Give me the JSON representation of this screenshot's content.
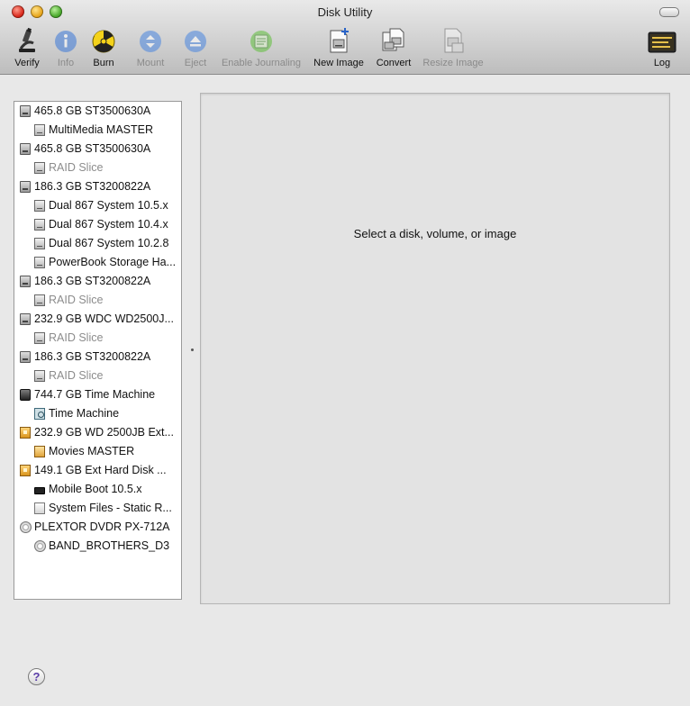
{
  "window": {
    "title": "Disk Utility"
  },
  "toolbar": {
    "items": [
      {
        "label": "Verify",
        "icon": "microscope-icon",
        "enabled": true
      },
      {
        "label": "Info",
        "icon": "info-icon",
        "enabled": false
      },
      {
        "label": "Burn",
        "icon": "burn-icon",
        "enabled": true
      },
      {
        "label": "Mount",
        "icon": "mount-icon",
        "enabled": false
      },
      {
        "label": "Eject",
        "icon": "eject-icon",
        "enabled": false
      },
      {
        "label": "Enable Journaling",
        "icon": "journaling-icon",
        "enabled": false
      },
      {
        "label": "New Image",
        "icon": "new-image-icon",
        "enabled": true
      },
      {
        "label": "Convert",
        "icon": "convert-icon",
        "enabled": true
      },
      {
        "label": "Resize Image",
        "icon": "resize-image-icon",
        "enabled": false
      },
      {
        "label": "Log",
        "icon": "log-icon",
        "enabled": true
      }
    ]
  },
  "sidebar": {
    "items": [
      {
        "label": "465.8 GB ST3500630A",
        "level": 0,
        "icon": "hard-disk-icon",
        "muted": false
      },
      {
        "label": "MultiMedia MASTER",
        "level": 1,
        "icon": "volume-icon",
        "muted": false
      },
      {
        "label": "465.8 GB ST3500630A",
        "level": 0,
        "icon": "hard-disk-icon",
        "muted": false
      },
      {
        "label": "RAID Slice",
        "level": 1,
        "icon": "volume-icon",
        "muted": true
      },
      {
        "label": "186.3 GB ST3200822A",
        "level": 0,
        "icon": "hard-disk-icon",
        "muted": false
      },
      {
        "label": "Dual 867 System 10.5.x",
        "level": 1,
        "icon": "volume-icon",
        "muted": false
      },
      {
        "label": "Dual 867 System 10.4.x",
        "level": 1,
        "icon": "volume-icon",
        "muted": false
      },
      {
        "label": "Dual 867 System 10.2.8",
        "level": 1,
        "icon": "volume-icon",
        "muted": false
      },
      {
        "label": "PowerBook Storage Ha...",
        "level": 1,
        "icon": "volume-icon",
        "muted": false
      },
      {
        "label": "186.3 GB ST3200822A",
        "level": 0,
        "icon": "hard-disk-icon",
        "muted": false
      },
      {
        "label": "RAID Slice",
        "level": 1,
        "icon": "volume-icon",
        "muted": true
      },
      {
        "label": "232.9 GB WDC WD2500J...",
        "level": 0,
        "icon": "hard-disk-icon",
        "muted": false
      },
      {
        "label": "RAID Slice",
        "level": 1,
        "icon": "volume-icon",
        "muted": true
      },
      {
        "label": "186.3 GB ST3200822A",
        "level": 0,
        "icon": "hard-disk-icon",
        "muted": false
      },
      {
        "label": "RAID Slice",
        "level": 1,
        "icon": "volume-icon",
        "muted": true
      },
      {
        "label": "744.7 GB Time Machine",
        "level": 0,
        "icon": "time-machine-disk-icon",
        "muted": false
      },
      {
        "label": "Time Machine",
        "level": 1,
        "icon": "time-machine-volume-icon",
        "muted": false
      },
      {
        "label": "232.9 GB WD 2500JB Ext...",
        "level": 0,
        "icon": "external-disk-icon",
        "muted": false
      },
      {
        "label": "Movies MASTER",
        "level": 1,
        "icon": "external-volume-icon",
        "muted": false
      },
      {
        "label": "149.1 GB Ext Hard Disk ...",
        "level": 0,
        "icon": "external-disk-icon",
        "muted": false
      },
      {
        "label": "Mobile Boot 10.5.x",
        "level": 1,
        "icon": "laptop-volume-icon",
        "muted": false
      },
      {
        "label": "System Files - Static R...",
        "level": 1,
        "icon": "generic-volume-icon",
        "muted": false
      },
      {
        "label": "PLEXTOR DVDR PX-712A",
        "level": 0,
        "icon": "optical-drive-icon",
        "muted": false
      },
      {
        "label": "BAND_BROTHERS_D3",
        "level": 1,
        "icon": "optical-disc-icon",
        "muted": false
      }
    ]
  },
  "detail": {
    "message": "Select a disk, volume, or image"
  },
  "help": {
    "label": "?"
  }
}
